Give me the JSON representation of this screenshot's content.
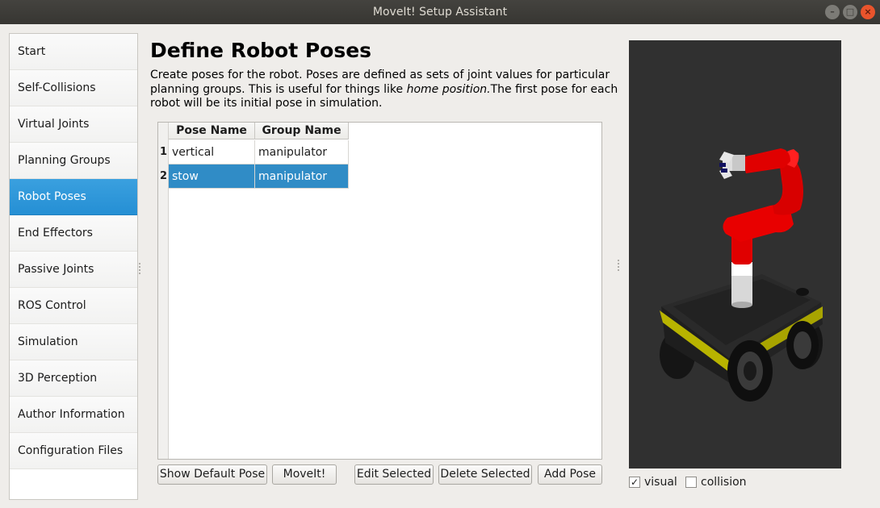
{
  "window": {
    "title": "MoveIt! Setup Assistant"
  },
  "sidebar": {
    "items": [
      {
        "label": "Start"
      },
      {
        "label": "Self-Collisions"
      },
      {
        "label": "Virtual Joints"
      },
      {
        "label": "Planning Groups"
      },
      {
        "label": "Robot Poses",
        "active": true
      },
      {
        "label": "End Effectors"
      },
      {
        "label": "Passive Joints"
      },
      {
        "label": "ROS Control"
      },
      {
        "label": "Simulation"
      },
      {
        "label": "3D Perception"
      },
      {
        "label": "Author Information"
      },
      {
        "label": "Configuration Files"
      }
    ]
  },
  "main": {
    "title": "Define Robot Poses",
    "description_1": "Create poses for the robot. Poses are defined as sets of joint values for particular planning groups. This is useful for things like ",
    "description_em": "home position.",
    "description_2": "The first pose for each robot will be its initial pose in simulation."
  },
  "table": {
    "columns": [
      "Pose Name",
      "Group Name"
    ],
    "rows": [
      {
        "num": "1",
        "pose": "vertical",
        "group": "manipulator",
        "selected": false
      },
      {
        "num": "2",
        "pose": "stow",
        "group": "manipulator",
        "selected": true
      }
    ]
  },
  "buttons": {
    "show_default": "Show Default Pose",
    "moveit": "MoveIt!",
    "edit": "Edit Selected",
    "delete": "Delete Selected",
    "add": "Add Pose"
  },
  "viewer": {
    "visual_label": "visual",
    "visual_checked": true,
    "collision_label": "collision",
    "collision_checked": false,
    "check_mark": "✓"
  },
  "colors": {
    "accent": "#308cc6",
    "robot_arm": "#e00000",
    "base_trim": "#c8c400"
  }
}
